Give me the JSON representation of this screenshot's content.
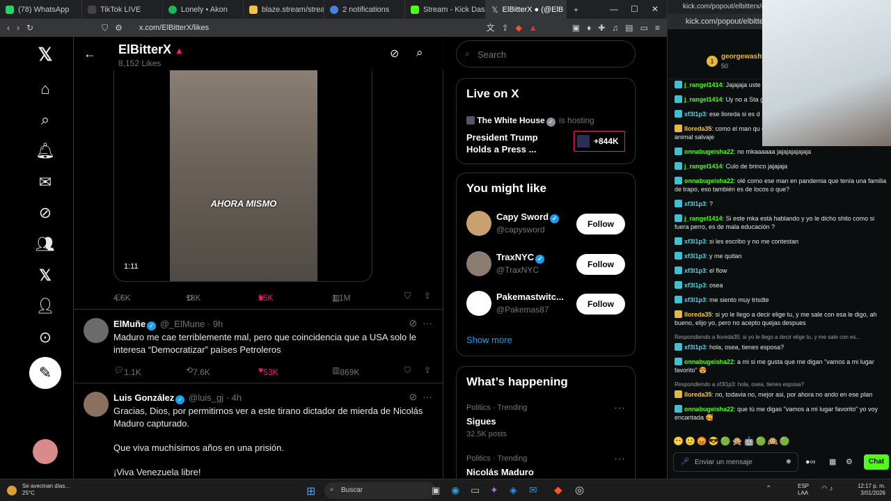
{
  "browser": {
    "tabs": [
      {
        "label": "(78) WhatsApp",
        "color": "#25d366"
      },
      {
        "label": "TikTok LIVE",
        "color": "#111111"
      },
      {
        "label": "Lonely • Akon",
        "color": "#1db954"
      },
      {
        "label": "blaze.stream/stream-se",
        "color": "#f2c14e"
      },
      {
        "label": "2 notifications",
        "color": "#4a7fe0"
      },
      {
        "label": "Stream - Kick Dashboa",
        "color": "#53fc18"
      },
      {
        "label": "ElBitterX ● (@ElB",
        "color": "#ffffff"
      }
    ],
    "url": "x.com/ElBitterX/likes"
  },
  "x": {
    "header": {
      "name": "ElBitterX",
      "likes": "8,152 Likes"
    },
    "video": {
      "caption": "AHORA MISMO",
      "duration": "1:11"
    },
    "video_actions": {
      "replies": "4.6K",
      "reposts": "18K",
      "likes": "55K",
      "views": "1.1M"
    },
    "tweets": [
      {
        "name": "ElMuñe",
        "meta": "@_ElMune · 9h",
        "text": "Maduro me cae terriblemente mal, pero que coincidencia que a USA solo le interesa “Democratizar” países Petroleros",
        "replies": "1.1K",
        "reposts": "7.6K",
        "likes": "53K",
        "views": "869K"
      },
      {
        "name": "Luis González",
        "meta": "@luis_gj · 4h",
        "text1": "Gracias, Dios, por permitirnos ver a este tirano dictador de mierda de Nicolás Maduro capturado.",
        "text2": "Que viva muchísimos años en una prisión.",
        "text3": "¡Viva Venezuela libre!"
      }
    ],
    "search_placeholder": "Search",
    "live": {
      "title": "Live on X",
      "host": "The White House",
      "hosting": "is hosting",
      "event": "President Trump Holds a Press ...",
      "count": "+844K"
    },
    "wtf": {
      "title": "You might like",
      "people": [
        {
          "name": "Capy Sword",
          "handle": "@capysword",
          "follow": "Follow"
        },
        {
          "name": "TraxNYC",
          "handle": "@TraxNYC",
          "follow": "Follow"
        },
        {
          "name": "Pakemastwitc...",
          "handle": "@Pakemas87",
          "follow": "Follow"
        }
      ],
      "show_more": "Show more"
    },
    "happening": {
      "title": "What’s happening",
      "items": [
        {
          "context": "Politics · Trending",
          "topic": "Sigues",
          "posts": "32.5K posts"
        },
        {
          "context": "Politics · Trending",
          "topic": "Nicolás Maduro"
        }
      ]
    }
  },
  "chat": {
    "title": "kick.com/popout/elbitterx/chat - K",
    "url": "kick.com/popout/elbitterx/",
    "top_user": "georgewasht",
    "top_amount": "50",
    "messages": [
      {
        "user": "j_rangel1414",
        "text": "Jajajaja uste",
        "color": "g"
      },
      {
        "user": "j_rangel1414",
        "text": "Uy no a Sta g",
        "color": "g"
      },
      {
        "user": "xf3l1p3",
        "text": "ese lloreda si es d",
        "color": "c"
      },
      {
        "user": "lloreda35",
        "text": "como el man qu ciervo a un bosque, y lo matare era un animal salvaje",
        "color": "o"
      },
      {
        "user": "onnabugeisha22",
        "text": "no mkaaaaaa jajajajajajaja",
        "color": "g"
      },
      {
        "user": "j_rangel1414",
        "text": "Culo de brinco jajajaja",
        "color": "g"
      },
      {
        "user": "onnabugeisha22",
        "text": "olé como ese man en pandemia que tenía una familia de trapo, eso también es de locos o que?",
        "color": "g"
      },
      {
        "user": "xf3l1p3",
        "text": "?",
        "color": "c"
      },
      {
        "user": "j_rangel1414",
        "text": "Si este mka está hablando y yo le dicho shito como si fuera perro, es de mala educación ?",
        "color": "g"
      },
      {
        "user": "xf3l1p3",
        "text": "si les escribo y no me contestan",
        "color": "c"
      },
      {
        "user": "xf3l1p3",
        "text": "y me quitan",
        "color": "c"
      },
      {
        "user": "xf3l1p3",
        "text": "el flow",
        "color": "c"
      },
      {
        "user": "xf3l1p3",
        "text": "osea",
        "color": "c"
      },
      {
        "user": "xf3l1p3",
        "text": "me siento muy trisdte",
        "color": "c"
      },
      {
        "user": "lloreda35",
        "text": "si yo le llego a decir elige tu, y me sale con esa le digo, ah bueno, elijo yo, pero no acepto quejas despues",
        "color": "o"
      },
      {
        "reply": "Respondiendo a lloreda35: si yo le llego a decir elige tu, y me sale con es...",
        "user": "xf3l1p3",
        "text": "hola, osea, tienes esposa?",
        "color": "c"
      },
      {
        "user": "onnabugeisha22",
        "text": "a mi si me gusta que me digan \"vamos a mi lugar favorito\" 😍",
        "color": "g"
      },
      {
        "reply": "Respondiendo a xf3l1p3: hola, osea, tienes esposa?",
        "user": "lloreda35",
        "text": "no, todavia no, mejor asi, por ahora no ando en ese plan",
        "color": "o"
      },
      {
        "user": "onnabugeisha22",
        "text": "que tú me digas \"vamos a mi lugar favorito\" yo voy encantada 🥰",
        "color": "g"
      }
    ],
    "input_placeholder": "Enviar un mensaje",
    "send": "Chat"
  },
  "taskbar": {
    "weather_line1": "Se avecinan días...",
    "weather_line2": "25°C",
    "search": "Buscar",
    "lang1": "ESP",
    "lang2": "LAA",
    "time": "12:17 p. m.",
    "date": "3/01/2026"
  }
}
